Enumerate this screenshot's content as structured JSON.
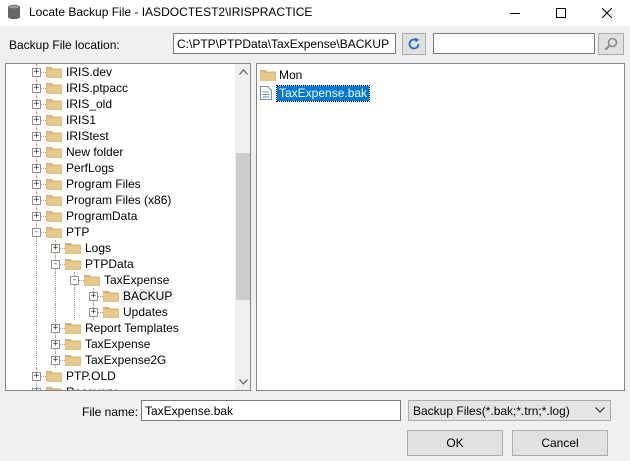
{
  "window": {
    "title": "Locate Backup File - IASDOCTEST2\\IRISPRACTICE",
    "app_icon": "database-icon",
    "controls": [
      "minimize-icon",
      "maximize-icon",
      "close-icon"
    ]
  },
  "location": {
    "label": "Backup File location:",
    "value": "C:\\PTP\\PTPData\\TaxExpense\\BACKUP",
    "refresh_icon": "refresh-icon",
    "search_value": "",
    "search_icon": "search-icon"
  },
  "tree": {
    "items": [
      {
        "label": "IRIS.dev",
        "depth": 0,
        "expanded": false
      },
      {
        "label": "IRIS.ptpacc",
        "depth": 0,
        "expanded": false
      },
      {
        "label": "IRIS_old",
        "depth": 0,
        "expanded": false
      },
      {
        "label": "IRIS1",
        "depth": 0,
        "expanded": false
      },
      {
        "label": "IRIStest",
        "depth": 0,
        "expanded": false
      },
      {
        "label": "New folder",
        "depth": 0,
        "expanded": false
      },
      {
        "label": "PerfLogs",
        "depth": 0,
        "expanded": false
      },
      {
        "label": "Program Files",
        "depth": 0,
        "expanded": false
      },
      {
        "label": "Program Files (x86)",
        "depth": 0,
        "expanded": false
      },
      {
        "label": "ProgramData",
        "depth": 0,
        "expanded": false
      },
      {
        "label": "PTP",
        "depth": 0,
        "expanded": true
      },
      {
        "label": "Logs",
        "depth": 1,
        "expanded": false
      },
      {
        "label": "PTPData",
        "depth": 1,
        "expanded": true
      },
      {
        "label": "TaxExpense",
        "depth": 2,
        "expanded": true
      },
      {
        "label": "BACKUP",
        "depth": 3,
        "expanded": false,
        "selected": true
      },
      {
        "label": "Updates",
        "depth": 3,
        "expanded": false
      },
      {
        "label": "Report Templates",
        "depth": 1,
        "expanded": false
      },
      {
        "label": "TaxExpense",
        "depth": 1,
        "expanded": false
      },
      {
        "label": "TaxExpense2G",
        "depth": 1,
        "expanded": false
      },
      {
        "label": "PTP.OLD",
        "depth": 0,
        "expanded": false
      },
      {
        "label": "Recovery",
        "depth": 0,
        "expanded": false
      }
    ]
  },
  "files": {
    "items": [
      {
        "label": "Mon",
        "icon": "folder-icon",
        "selected": false
      },
      {
        "label": "TaxExpense.bak",
        "icon": "document-icon",
        "selected": true
      }
    ]
  },
  "footer": {
    "file_name_label": "File name:",
    "file_name_value": "TaxExpense.bak",
    "file_type_value": "Backup Files(*.bak;*.trn;*.log)",
    "ok_label": "OK",
    "cancel_label": "Cancel"
  },
  "colors": {
    "selection": "#0078d7",
    "folder": "#dcb67a"
  }
}
